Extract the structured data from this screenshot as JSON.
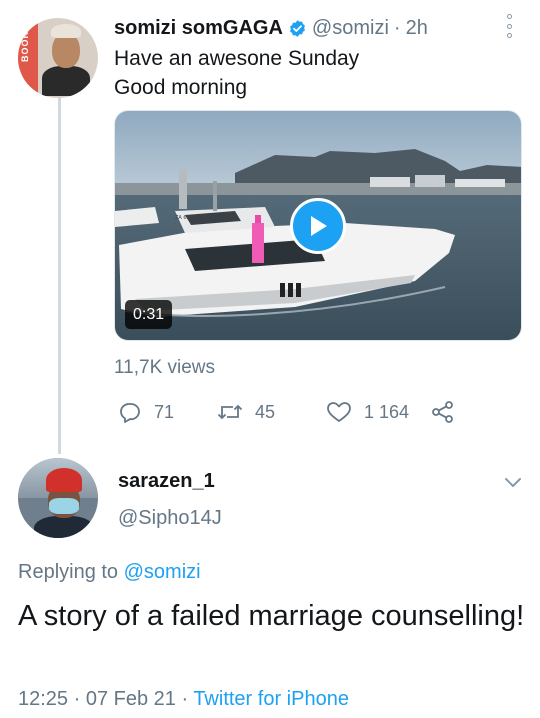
{
  "tweet": {
    "author_name": "somizi somGAGA",
    "author_handle": "@somizi",
    "separator": "·",
    "time": "2h",
    "avatar_badge_text": "BOOKINGS",
    "text_lines": [
      "Have an awesone Sunday",
      "Good morning"
    ],
    "video": {
      "duration": "0:31",
      "boat_registration": "ZA 6598"
    },
    "views": "11,7K views",
    "actions": {
      "replies": "71",
      "retweets": "45",
      "likes": "1 164"
    }
  },
  "reply": {
    "author_name": "sarazen_1",
    "author_handle": "@Sipho14J",
    "replying_prefix": "Replying to",
    "replying_mention": "@somizi",
    "text": "A story of a failed marriage counselling!",
    "timestamp": "12:25 · 07 Feb 21 · ",
    "source": "Twitter for iPhone"
  },
  "colors": {
    "accent": "#1da1f2",
    "secondary_text": "#657786",
    "primary_text": "#14171a"
  },
  "icons": [
    "verified-badge-icon",
    "more-options-icon",
    "play-icon",
    "reply-icon",
    "retweet-icon",
    "like-icon",
    "share-icon",
    "chevron-down-icon"
  ]
}
